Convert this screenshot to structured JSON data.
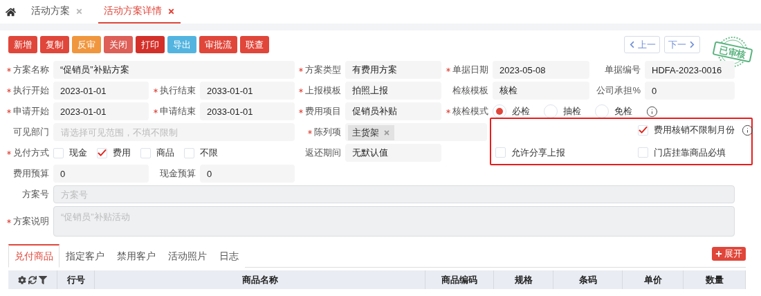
{
  "nav_tabs": [
    {
      "label": "活动方案",
      "selected": false
    },
    {
      "label": "活动方案详情",
      "selected": true
    }
  ],
  "toolbar": {
    "buttons": [
      {
        "label": "新增",
        "kind": "primary"
      },
      {
        "label": "复制",
        "kind": "primary"
      },
      {
        "label": "反审",
        "kind": "warning"
      },
      {
        "label": "关闭",
        "kind": "muted"
      },
      {
        "label": "打印",
        "kind": "dark"
      },
      {
        "label": "导出",
        "kind": "info"
      },
      {
        "label": "审批流",
        "kind": "primary"
      },
      {
        "label": "联查",
        "kind": "primary"
      }
    ],
    "pager": [
      {
        "label": "上一",
        "kind": "prev"
      },
      {
        "label": "下一",
        "kind": "next"
      }
    ],
    "stamp": "已审核"
  },
  "form": {
    "fields": [
      {
        "label": "方案名称",
        "required": true,
        "kind": "text",
        "value": "“促销员”补贴方案"
      },
      {
        "label": "方案类型",
        "required": true,
        "kind": "text",
        "value": "有费用方案"
      },
      {
        "label": "单据日期",
        "required": true,
        "kind": "text",
        "value": "2023-05-08"
      },
      {
        "label": "单据编号",
        "required": false,
        "kind": "text",
        "value": "HDFA-2023-0016"
      },
      {
        "label": "执行开始",
        "required": true,
        "kind": "text",
        "value": "2023-01-01"
      },
      {
        "label": "执行结束",
        "required": true,
        "kind": "text",
        "value": "2033-01-01"
      },
      {
        "label": "上报模板",
        "required": true,
        "kind": "text",
        "value": "拍照上报"
      },
      {
        "label": "检核模板",
        "required": false,
        "kind": "text",
        "value": "核检"
      },
      {
        "label": "公司承担%",
        "required": false,
        "kind": "text",
        "value": "0"
      },
      {
        "label": "申请开始",
        "required": true,
        "kind": "text",
        "value": "2023-01-01"
      },
      {
        "label": "申请结束",
        "required": true,
        "kind": "text",
        "value": "2033-01-01"
      },
      {
        "label": "费用项目",
        "required": true,
        "kind": "text",
        "value": "促销员补贴"
      },
      {
        "label": "核检模式",
        "required": true,
        "kind": "radio",
        "info": true,
        "options": [
          {
            "label": "必检",
            "selected": true
          },
          {
            "label": "抽检",
            "selected": false
          },
          {
            "label": "免检",
            "selected": false
          }
        ]
      },
      {
        "label": "可见部门",
        "required": false,
        "kind": "input",
        "disabled": false,
        "placeholder": "请选择可见范围，不填不限制"
      },
      {
        "label": "陈列项",
        "required": true,
        "kind": "tags",
        "tags": [
          "主货架"
        ]
      },
      {
        "label": "兑付方式",
        "required": true,
        "kind": "checks",
        "options": [
          {
            "label": "现金",
            "checked": false
          },
          {
            "label": "费用",
            "checked": true
          },
          {
            "label": "商品",
            "checked": false
          },
          {
            "label": "不限",
            "checked": false
          }
        ]
      },
      {
        "label": "返还期间",
        "required": false,
        "kind": "text",
        "value": "无默认值"
      },
      {
        "label": "费用预算",
        "required": false,
        "kind": "text",
        "value": "0"
      },
      {
        "label": "现金预算",
        "required": false,
        "kind": "text",
        "value": "0"
      },
      {
        "label": "方案号",
        "required": false,
        "kind": "input",
        "disabled": true,
        "placeholder": "方案号"
      },
      {
        "label": "方案说明",
        "required": true,
        "kind": "textarea",
        "disabled": true,
        "placeholder": "“促销员”补贴活动"
      }
    ],
    "highlight_options": [
      {
        "label": "费用核销不限制月份",
        "checked": true,
        "info": true
      },
      {
        "label": "允许分享上报",
        "checked": false,
        "info": false
      },
      {
        "label": "门店挂靠商品必填",
        "checked": false,
        "info": false
      }
    ]
  },
  "detail_tabs": [
    {
      "label": "兑付商品",
      "selected": true
    },
    {
      "label": "指定客户",
      "selected": false
    },
    {
      "label": "禁用客户",
      "selected": false
    },
    {
      "label": "活动照片",
      "selected": false
    },
    {
      "label": "日志",
      "selected": false
    }
  ],
  "expand_button": "展开",
  "table": {
    "columns": [
      "行号",
      "商品名称",
      "商品编码",
      "规格",
      "条码",
      "单价",
      "数量"
    ]
  }
}
